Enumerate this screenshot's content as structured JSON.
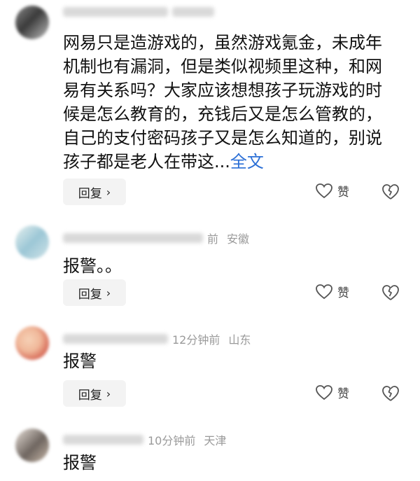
{
  "comments": [
    {
      "meta_region": "",
      "meta_time": "",
      "body": "网易只是造游戏的，虽然游戏氪金，未成年机制也有漏洞，但是类似视频里这种，和网易有关系吗？大家应该想想孩子玩游戏的时候是怎么教育的，充钱后又是怎么管教的，自己的支付密码孩子又是怎么知道的，别说孩子都是老人在带这...",
      "more_label": "全文",
      "reply_label": "回复",
      "like_label": "赞",
      "avatar_colors": [
        "#8a8a8a",
        "#3b3b3b",
        "#bdbdbd"
      ]
    },
    {
      "meta_time": "前",
      "meta_region": "安徽",
      "body": "报警。。",
      "reply_label": "回复",
      "like_label": "赞",
      "avatar_colors": [
        "#cfe3e8",
        "#9cc7d6",
        "#e6f0ef"
      ]
    },
    {
      "meta_time": "12分钟前",
      "meta_region": "山东",
      "body": "报警",
      "reply_label": "回复",
      "like_label": "赞",
      "avatar_colors": [
        "#d25a4a",
        "#f0b89a",
        "#f6d1b6"
      ]
    },
    {
      "meta_time": "10分钟前",
      "meta_region": "天津",
      "body": "报警",
      "avatar_colors": [
        "#6f6660",
        "#c9b9aa",
        "#e7dfd8"
      ]
    }
  ],
  "icons": {
    "like": "heart-outline-icon",
    "dislike": "broken-heart-icon",
    "reply_arrow": "chevron-right-icon"
  }
}
